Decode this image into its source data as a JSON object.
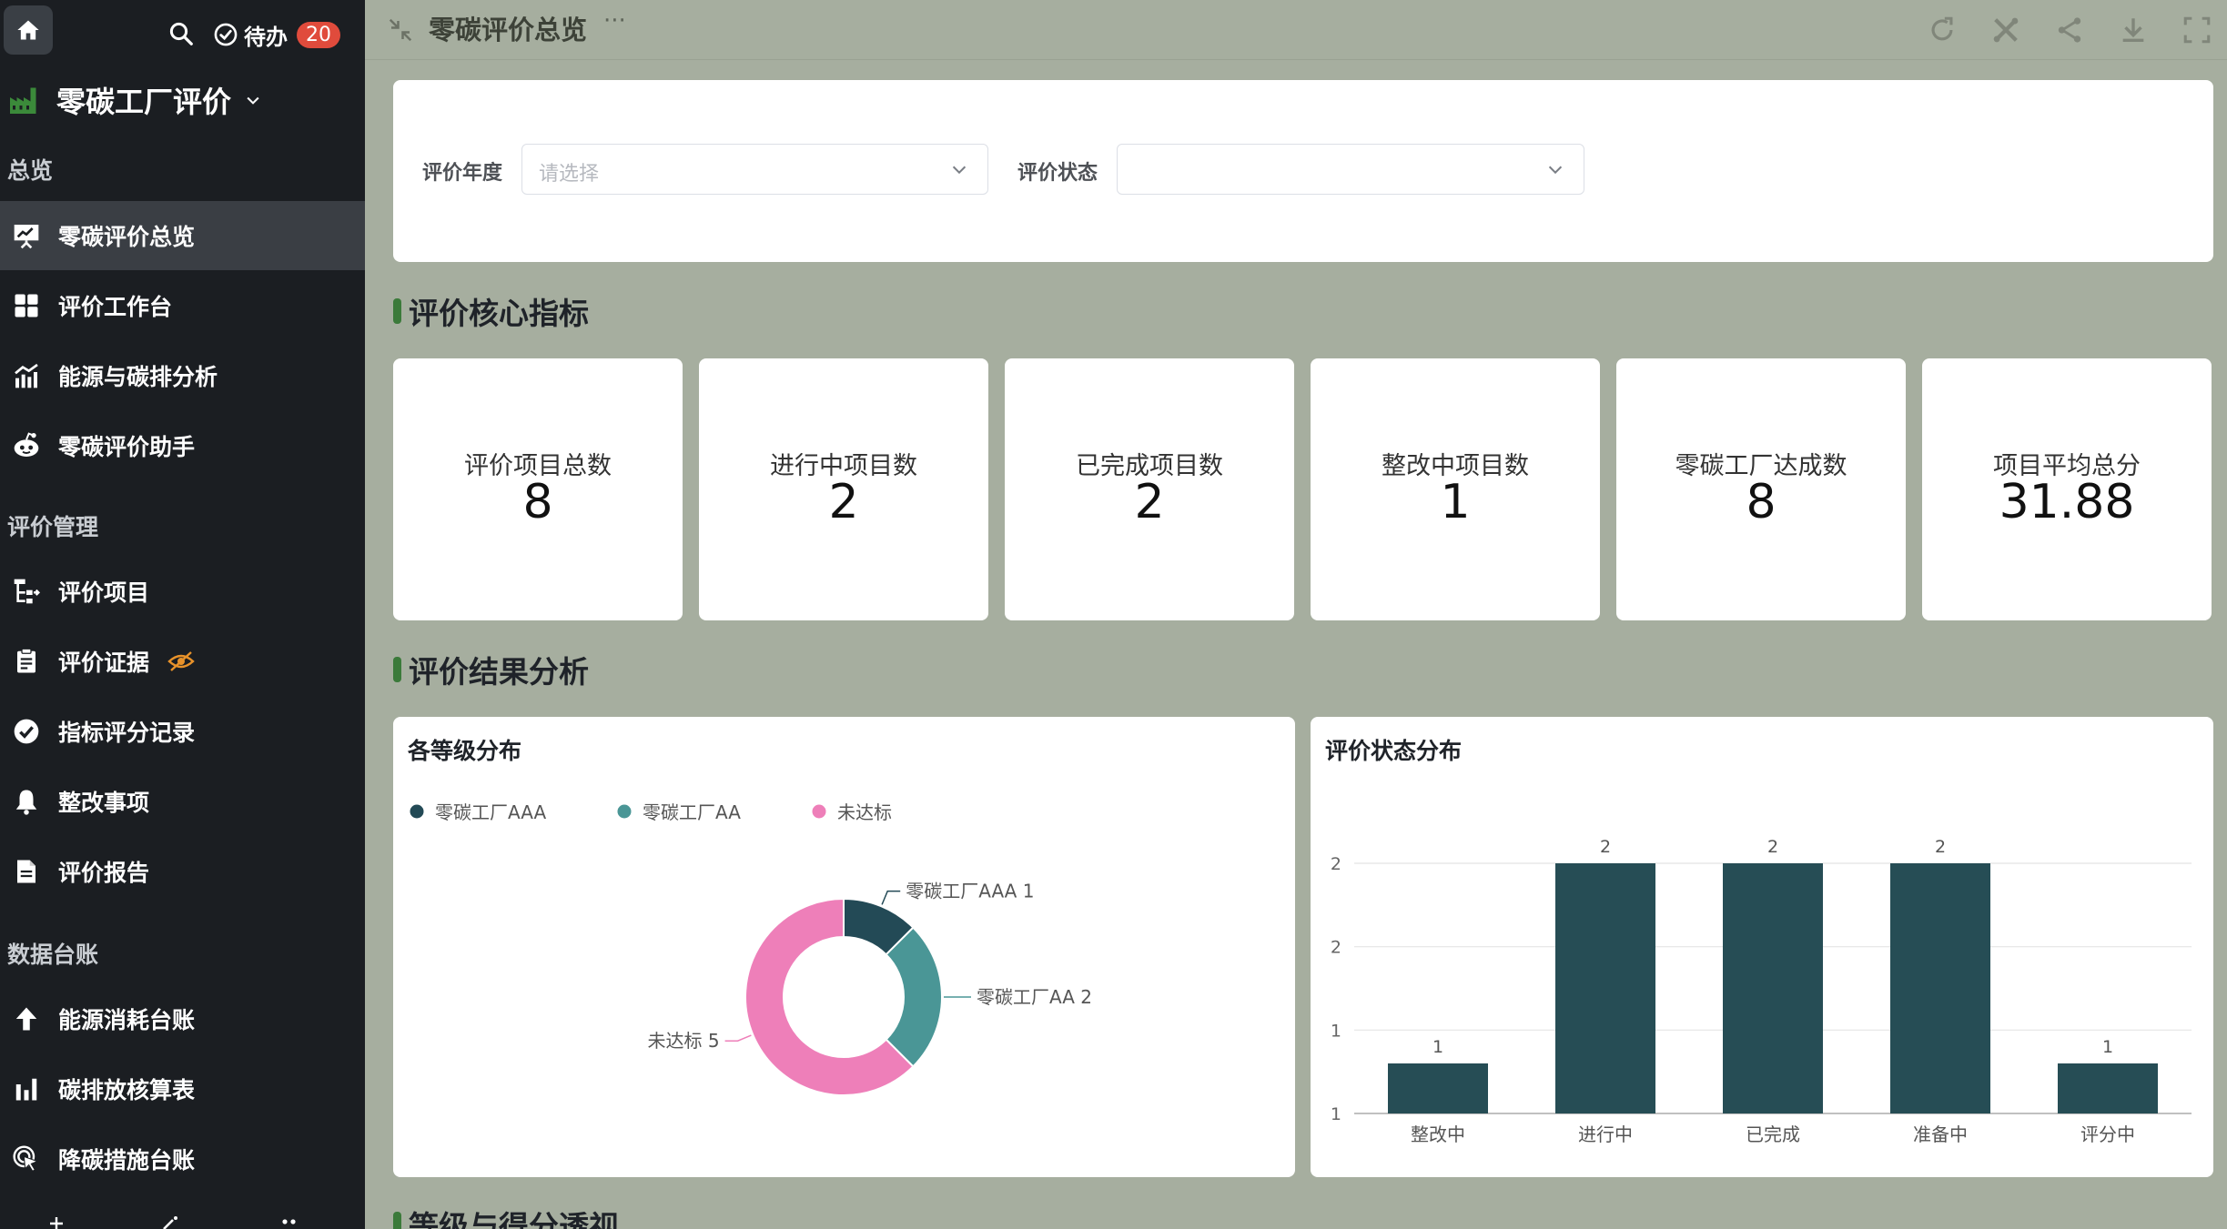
{
  "header": {
    "todo_label": "待办",
    "todo_count": "20",
    "app_title": "零碳工厂评价"
  },
  "sidebar": {
    "sections": [
      {
        "label": "总览",
        "items": [
          {
            "label": "零碳评价总览",
            "icon": "presentation-chart-icon",
            "active": true
          },
          {
            "label": "评价工作台",
            "icon": "grid-icon"
          },
          {
            "label": "能源与碳排分析",
            "icon": "line-bar-chart-icon"
          },
          {
            "label": "零碳评价助手",
            "icon": "robot-icon"
          }
        ]
      },
      {
        "label": "评价管理",
        "items": [
          {
            "label": "评价项目",
            "icon": "flow-icon"
          },
          {
            "label": "评价证据",
            "icon": "clipboard-icon",
            "hidden_badge": "eye-off-icon"
          },
          {
            "label": "指标评分记录",
            "icon": "check-circle-icon"
          },
          {
            "label": "整改事项",
            "icon": "bell-icon"
          },
          {
            "label": "评价报告",
            "icon": "document-icon"
          }
        ]
      },
      {
        "label": "数据台账",
        "items": [
          {
            "label": "能源消耗台账",
            "icon": "arrow-up-icon"
          },
          {
            "label": "碳排放核算表",
            "icon": "bar-chart-icon"
          },
          {
            "label": "降碳措施台账",
            "icon": "cursor-click-icon"
          }
        ]
      }
    ]
  },
  "topbar": {
    "title": "零碳评价总览",
    "more": "···"
  },
  "filters": {
    "year_label": "评价年度",
    "year_placeholder": "请选择",
    "status_label": "评价状态",
    "status_placeholder": ""
  },
  "sections": {
    "kpi_title": "评价核心指标",
    "analysis_title": "评价结果分析",
    "bottom_title": "等级与得分透视"
  },
  "kpis": [
    {
      "label": "评价项目总数",
      "value": "8"
    },
    {
      "label": "进行中项目数",
      "value": "2"
    },
    {
      "label": "已完成项目数",
      "value": "2"
    },
    {
      "label": "整改中项目数",
      "value": "1"
    },
    {
      "label": "零碳工厂达成数",
      "value": "8"
    },
    {
      "label": "项目平均总分",
      "value": "31.88"
    }
  ],
  "colors": {
    "sidebar_bg": "#1b1e22",
    "accent_green": "#3b7a3a",
    "badge_red": "#e04b3c",
    "bar_color": "#264d55",
    "aaa": "#234a56",
    "aa": "#4a9696",
    "fail": "#ee7fb9"
  },
  "chart_data": [
    {
      "type": "pie",
      "title": "各等级分布",
      "legend_position": "top-left",
      "categories": [
        "零碳工厂AAA",
        "零碳工厂AA",
        "未达标"
      ],
      "values": [
        1,
        2,
        5
      ],
      "colors": [
        "#234a56",
        "#4a9696",
        "#ee7fb9"
      ],
      "donut": true
    },
    {
      "type": "bar",
      "title": "评价状态分布",
      "categories": [
        "整改中",
        "进行中",
        "已完成",
        "准备中",
        "评分中"
      ],
      "values": [
        1,
        2,
        2,
        2,
        1
      ],
      "ytick_labels": [
        "1",
        "1",
        "2",
        "2"
      ],
      "ylim": [
        0.75,
        2
      ],
      "grid": true
    }
  ]
}
